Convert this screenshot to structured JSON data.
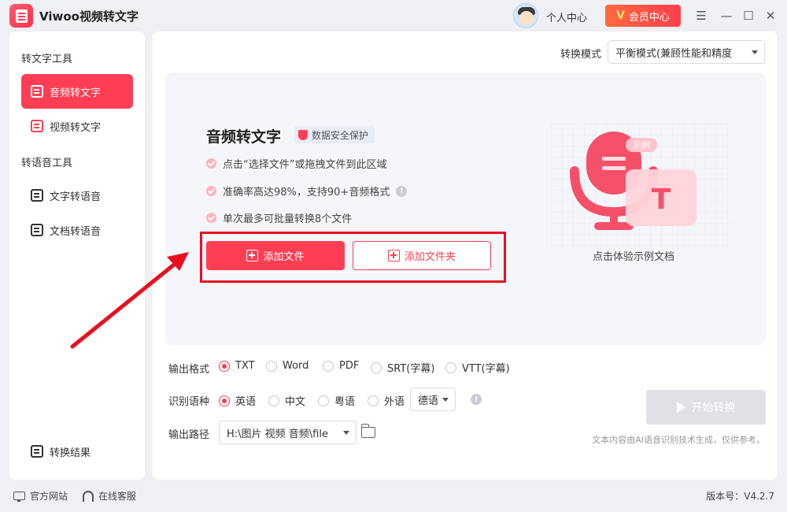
{
  "app": {
    "title": "Viwoo视频转文字"
  },
  "header": {
    "user_center": "个人中心",
    "vip_label": "会员中心",
    "vip_icon": "V"
  },
  "sidebar": {
    "group1": "转文字工具",
    "items1": [
      {
        "label": "音频转文字"
      },
      {
        "label": "视频转文字"
      }
    ],
    "group2": "转语音工具",
    "items2": [
      {
        "label": "文字转语音"
      },
      {
        "label": "文档转语音"
      }
    ],
    "result": "转换结果"
  },
  "main": {
    "mode_label": "转换模式",
    "mode_value": "平衡模式(兼顾性能和精度",
    "dropzone": {
      "title": "音频转文字",
      "badge": "数据安全保护",
      "bullets": [
        "点击“选择文件”或拖拽文件到此区域",
        "准确率高达98%，支持90+音频格式",
        "单次最多可批量转换8个文件"
      ],
      "add_file": "添加文件",
      "add_folder": "添加文件夹",
      "sample_tag": "示例",
      "sample_letter": "T",
      "sample_caption": "点击体验示例文档"
    },
    "output_format": {
      "label": "输出格式",
      "options": [
        "TXT",
        "Word",
        "PDF",
        "SRT(字幕)",
        "VTT(字幕)"
      ],
      "selected": "TXT"
    },
    "language": {
      "label": "识别语种",
      "options": [
        "英语",
        "中文",
        "粤语",
        "外语"
      ],
      "selected": "英语",
      "foreign_value": "德语"
    },
    "output_path": {
      "label": "输出路径",
      "value": "H:\\图片 视频 音频\\file"
    },
    "start_button": "开始转换",
    "disclaimer": "文本内容由AI语音识别技术生成，仅供参考。"
  },
  "footer": {
    "website": "官方网站",
    "service": "在线客服",
    "version": "版本号：V4.2.7"
  },
  "colors": {
    "accent": "#ff3e54",
    "highlight": "#e8101f"
  }
}
